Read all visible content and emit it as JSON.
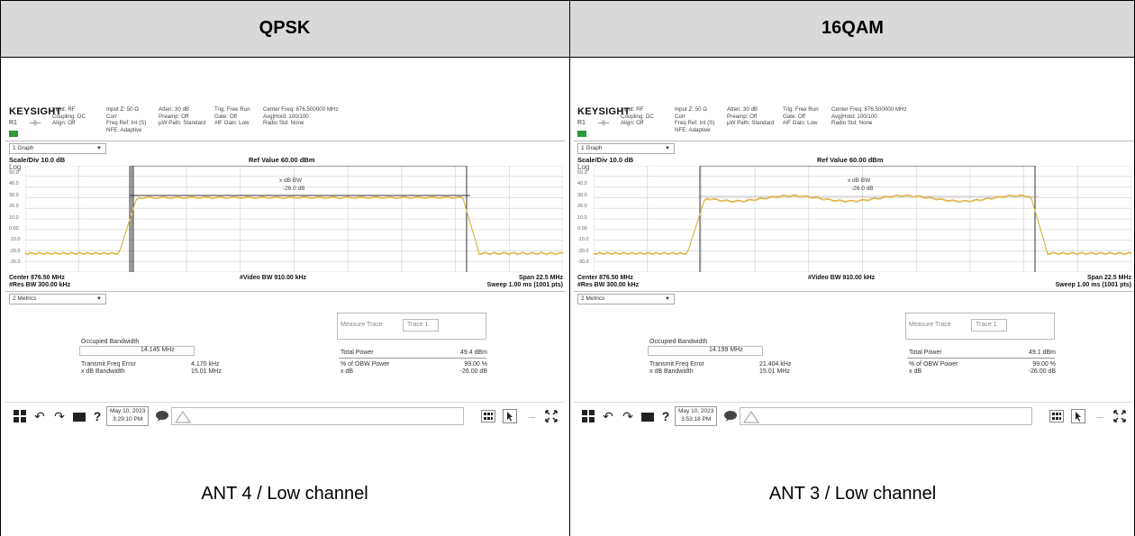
{
  "columns": [
    {
      "header": "QPSK",
      "caption": "ANT 4 / Low channel",
      "instrument": {
        "brand": "KEYSIGHT",
        "r1": "R1",
        "info_blocks": [
          "Input: RF\nCoupling: DC\nAlign: Off",
          "Input Z: 50 Ω\nCorr\nFreq Ref: Int (S)\nNFE: Adaptive",
          "Atten: 30 dB\nPreamp: Off\nμW Path: Standard",
          "Trig: Free Run\nGate: Off\n#IF Gain: Low",
          "Center Freq: 876.500000 MHz\nAvg|Hold: 100/100\nRadio Std: None"
        ],
        "graph_selector": "1 Graph",
        "scale_div": "Scale/Div 10.0 dB",
        "ref_value": "Ref Value 60.00 dBm",
        "log": "Log",
        "yticks": [
          "50.0",
          "40.0",
          "30.0",
          "20.0",
          "10.0",
          "0.00",
          "-10.0",
          "-20.0",
          "-30.0"
        ],
        "marker_label": "x dB BW",
        "marker_value": "-26.0 dB",
        "center": "Center 876.50 MHz",
        "res_bw": "#Res BW 300.00 kHz",
        "video_bw": "#Video BW 910.00 kHz",
        "span": "Span 22.5 MHz",
        "sweep": "Sweep 1.00 ms (1001 pts)",
        "metrics_selector": "2 Metrics",
        "measure_trace": "Measure Trace",
        "trace": "Trace 1",
        "occupied_bw_label": "Occupied Bandwidth",
        "occupied_bw_value": "14.145 MHz",
        "total_power_label": "Total Power",
        "total_power_value": "49.4 dBm",
        "tx_freq_error_label": "Transmit Freq Error",
        "tx_freq_error_value": "4.170 kHz",
        "obw_power_label": "% of OBW Power",
        "obw_power_value": "99.00 %",
        "xdb_bw_label": "x dB Bandwidth",
        "xdb_bw_value": "15.01 MHz",
        "xdb_label": "x dB",
        "xdb_value": "-26.00 dB",
        "date": "May 10, 2023",
        "time": "3:29:10 PM"
      }
    },
    {
      "header": "16QAM",
      "caption": "ANT 3 / Low channel",
      "instrument": {
        "brand": "KEYSIGHT",
        "r1": "R1",
        "info_blocks": [
          "Input: RF\nCoupling: DC\nAlign: Off",
          "Input Z: 50 Ω\nCorr\nFreq Ref: Int (S)\nNFE: Adaptive",
          "Atten: 30 dB\nPreamp: Off\nμW Path: Standard",
          "Trig: Free Run\nGate: Off\n#IF Gain: Low",
          "Center Freq: 876.500000 MHz\nAvg|Hold: 100/100\nRadio Std: None"
        ],
        "graph_selector": "1 Graph",
        "scale_div": "Scale/Div 10.0 dB",
        "ref_value": "Ref Value 60.00 dBm",
        "log": "Log",
        "yticks": [
          "50.0",
          "40.0",
          "30.0",
          "20.0",
          "10.0",
          "0.00",
          "-10.0",
          "-20.0",
          "-30.0"
        ],
        "marker_label": "x dB BW",
        "marker_value": "-26.0 dB",
        "center": "Center 876.50 MHz",
        "res_bw": "#Res BW 300.00 kHz",
        "video_bw": "#Video BW 910.00 kHz",
        "span": "Span 22.5 MHz",
        "sweep": "Sweep 1.00 ms (1001 pts)",
        "metrics_selector": "2 Metrics",
        "measure_trace": "Measure Trace",
        "trace": "Trace 1",
        "occupied_bw_label": "Occupied Bandwidth",
        "occupied_bw_value": "14.199 MHz",
        "total_power_label": "Total Power",
        "total_power_value": "49.1 dBm",
        "tx_freq_error_label": "Transmit Freq Error",
        "tx_freq_error_value": "21.404 kHz",
        "obw_power_label": "% of OBW Power",
        "obw_power_value": "99.00 %",
        "xdb_bw_label": "x dB Bandwidth",
        "xdb_bw_value": "15.01 MHz",
        "xdb_label": "x dB",
        "xdb_value": "-26.00 dB",
        "date": "May 10, 2023",
        "time": "3:53:18 PM"
      }
    }
  ],
  "colors": {
    "header_bg": "#d9d9d9",
    "trace": "#e8a33a",
    "trace_alt": "#c8c83a",
    "grid": "#cfcfcf"
  },
  "icons": [
    "windows-icon",
    "undo-icon",
    "redo-icon",
    "folder-icon",
    "help-icon",
    "chat-icon",
    "triangle-icon",
    "grid-icon",
    "cursor-icon",
    "expand-icon"
  ]
}
